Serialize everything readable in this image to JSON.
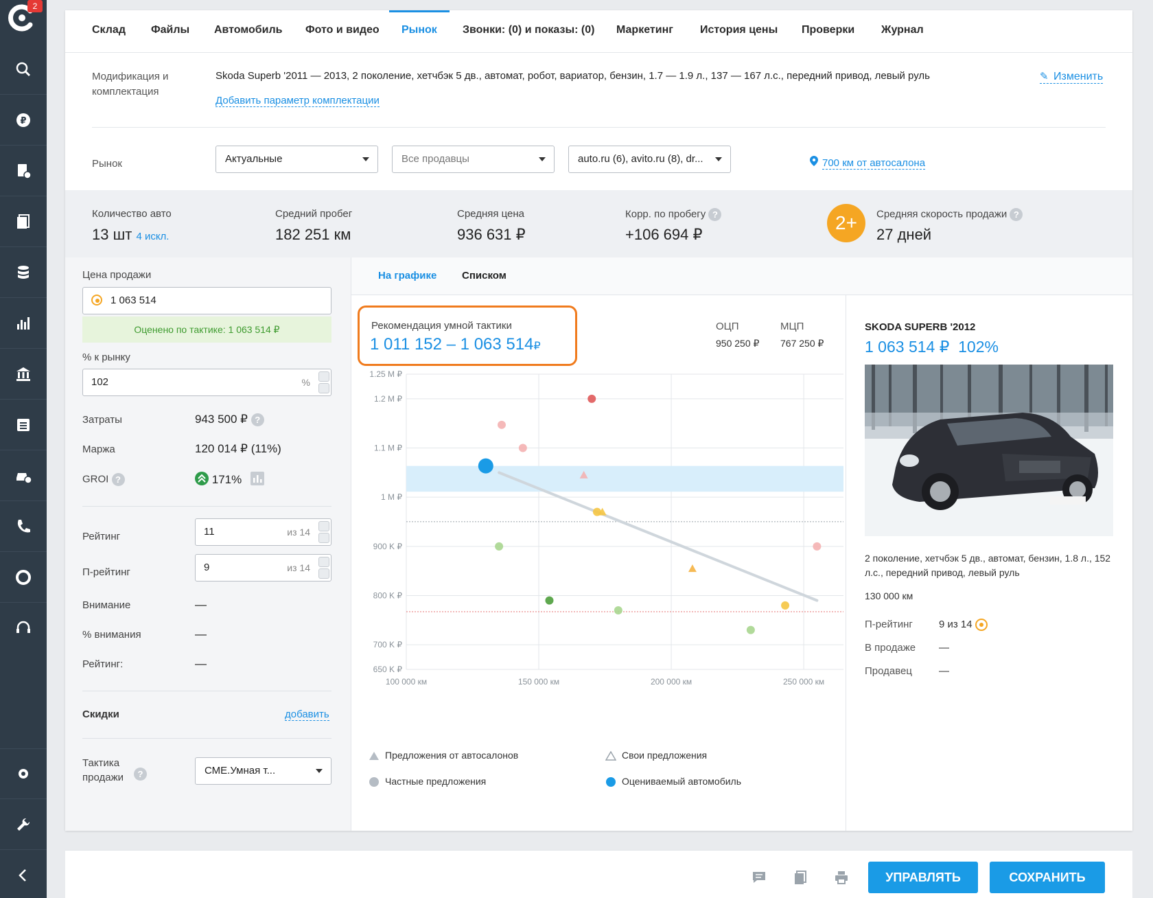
{
  "colors": {
    "accent": "#1a8fe3",
    "orange": "#f07b1d",
    "badge": "#f5a623",
    "sidebar": "#2f3c48"
  },
  "sidebar": {
    "badge": "2",
    "items": [
      "search-car-icon",
      "ruble-icon",
      "document-add-icon",
      "documents-icon",
      "database-icon",
      "chart-bar-icon",
      "bank-icon",
      "list-icon",
      "car-add-icon",
      "phone-icon",
      "lifebuoy-icon",
      "headset-icon",
      "gear-icon",
      "wrench-icon",
      "chevron-left-icon"
    ]
  },
  "tabs": [
    "Склад",
    "Файлы",
    "Автомобиль",
    "Фото и видео",
    "Рынок",
    "Звонки: (0) и показы: (0)",
    "Маркетинг",
    "История цены",
    "Проверки",
    "Журнал"
  ],
  "active_tab": "Рынок",
  "modification": {
    "label": "Модификация и комплектация",
    "text": "Skoda Superb '2011 — 2013, 2 поколение, хетчбэк 5 дв., автомат, робот, вариатор, бензин, 1.7 — 1.9 л., 137 — 167 л.с., передний привод, левый руль",
    "add_link": "Добавить параметр комплектации",
    "edit_link": "Изменить"
  },
  "market": {
    "label": "Рынок",
    "filter1": "Актуальные",
    "filter2": "Все продавцы",
    "filter3": "auto.ru (6), avito.ru (8), dr...",
    "location": "700 км от автосалона"
  },
  "stats": {
    "count_label": "Количество авто",
    "count_value": "13 шт",
    "count_excl": "4 искл.",
    "mileage_label": "Средний пробег",
    "mileage_value": "182 251 км",
    "price_label": "Средняя цена",
    "price_value": "936 631 ₽",
    "corr_label": "Корр. по пробегу",
    "corr_value": "+106 694 ₽",
    "speed_badge": "2+",
    "speed_label": "Средняя скорость продажи",
    "speed_value": "27 дней",
    "help": "?"
  },
  "left": {
    "price_label": "Цена продажи",
    "price_value": "1 063 514",
    "evaluated": "Оценено по тактике: 1 063 514 ₽",
    "pct_label": "% к рынку",
    "pct_value": "102",
    "pct_suffix": "%",
    "costs_label": "Затраты",
    "costs_value": "943 500 ₽",
    "margin_label": "Маржа",
    "margin_value": "120 014 ₽ (11%)",
    "groi_label": "GROI",
    "groi_value": "171%",
    "rating_label": "Рейтинг",
    "rating_value": "11",
    "of_total": "из 14",
    "prating_label": "П-рейтинг",
    "prating_value": "9",
    "attention_label": "Внимание",
    "attention_value": "—",
    "attention_pct_label": "% внимания",
    "attention_pct_value": "—",
    "rating2_label": "Рейтинг:",
    "rating2_value": "—",
    "discounts_label": "Скидки",
    "discounts_add": "добавить",
    "tactic_label": "Тактика продажи",
    "tactic_value": "СМЕ.Умная т..."
  },
  "main": {
    "subtab_chart": "На графике",
    "subtab_list": "Списком",
    "rec_title": "Рекомендация умной тактики",
    "rec_range": "1 011 152 – 1 063 514",
    "rec_currency": "₽",
    "ocp_label": "ОЦП",
    "ocp_value": "950 250 ₽",
    "mcp_label": "МЦП",
    "mcp_value": "767 250 ₽",
    "legend": [
      "Предложения от автосалонов",
      "Свои предложения",
      "Частные предложения",
      "Оцениваемый автомобиль"
    ]
  },
  "chart_data": {
    "type": "scatter",
    "x_unit": "km",
    "y_unit": "₽",
    "xlim": [
      100000,
      265000
    ],
    "ylim": [
      650000,
      1250000
    ],
    "x_ticks": [
      100000,
      150000,
      200000,
      250000
    ],
    "x_tick_labels": [
      "100 000 км",
      "150 000 км",
      "200 000 км",
      "250 000 км"
    ],
    "y_ticks": [
      650000,
      700000,
      800000,
      900000,
      1000000,
      1100000,
      1200000,
      1250000
    ],
    "y_tick_labels": [
      "650 K ₽",
      "700 K ₽",
      "800 K ₽",
      "900 K ₽",
      "1 M ₽",
      "1.1 M ₽",
      "1.2 M ₽",
      "1.25 M ₽"
    ],
    "recommendation_band": [
      1011152,
      1063514
    ],
    "reference_lines": [
      {
        "value": 950250,
        "color": "#9aa3ab"
      },
      {
        "value": 767250,
        "color": "#e57373"
      }
    ],
    "trend": [
      {
        "x": 135000,
        "y": 1050000
      },
      {
        "x": 255000,
        "y": 790000
      }
    ],
    "evaluated_car": {
      "x": 130000,
      "y": 1063514
    },
    "points": [
      {
        "x": 170000,
        "y": 1200000,
        "shape": "circle",
        "color": "#e05a5a"
      },
      {
        "x": 136000,
        "y": 1147000,
        "shape": "circle",
        "color": "#f4b1b1"
      },
      {
        "x": 144000,
        "y": 1100000,
        "shape": "circle",
        "color": "#f4b1b1"
      },
      {
        "x": 167000,
        "y": 1045000,
        "shape": "triangle",
        "color": "#f4b1b1"
      },
      {
        "x": 172000,
        "y": 970000,
        "shape": "circle",
        "color": "#f5c542"
      },
      {
        "x": 174000,
        "y": 970000,
        "shape": "triangle",
        "color": "#f5c542"
      },
      {
        "x": 135000,
        "y": 900000,
        "shape": "circle",
        "color": "#a8d68f"
      },
      {
        "x": 255000,
        "y": 900000,
        "shape": "circle",
        "color": "#f4b1b1"
      },
      {
        "x": 208000,
        "y": 855000,
        "shape": "triangle",
        "color": "#f5b342"
      },
      {
        "x": 154000,
        "y": 790000,
        "shape": "circle",
        "color": "#4e9e3c"
      },
      {
        "x": 180000,
        "y": 770000,
        "shape": "circle",
        "color": "#a8d68f"
      },
      {
        "x": 243000,
        "y": 780000,
        "shape": "circle",
        "color": "#f5c542"
      },
      {
        "x": 230000,
        "y": 730000,
        "shape": "circle",
        "color": "#a8d68f"
      }
    ]
  },
  "details": {
    "title": "SKODA SUPERB '2012",
    "price": "1 063 514 ₽",
    "pct": "102%",
    "desc": "2 поколение, хетчбэк 5 дв., автомат, бензин, 1.8 л., 152 л.с., передний привод, левый руль",
    "km": "130 000 км",
    "prating_label": "П-рейтинг",
    "prating_value": "9 из 14",
    "on_sale_label": "В продаже",
    "on_sale_value": "—",
    "seller_label": "Продавец",
    "seller_value": "—"
  },
  "bottom": {
    "tools": [
      "comment-icon",
      "copy-icon",
      "print-icon"
    ],
    "manage": "УПРАВЛЯТЬ",
    "save": "СОХРАНИТЬ"
  }
}
